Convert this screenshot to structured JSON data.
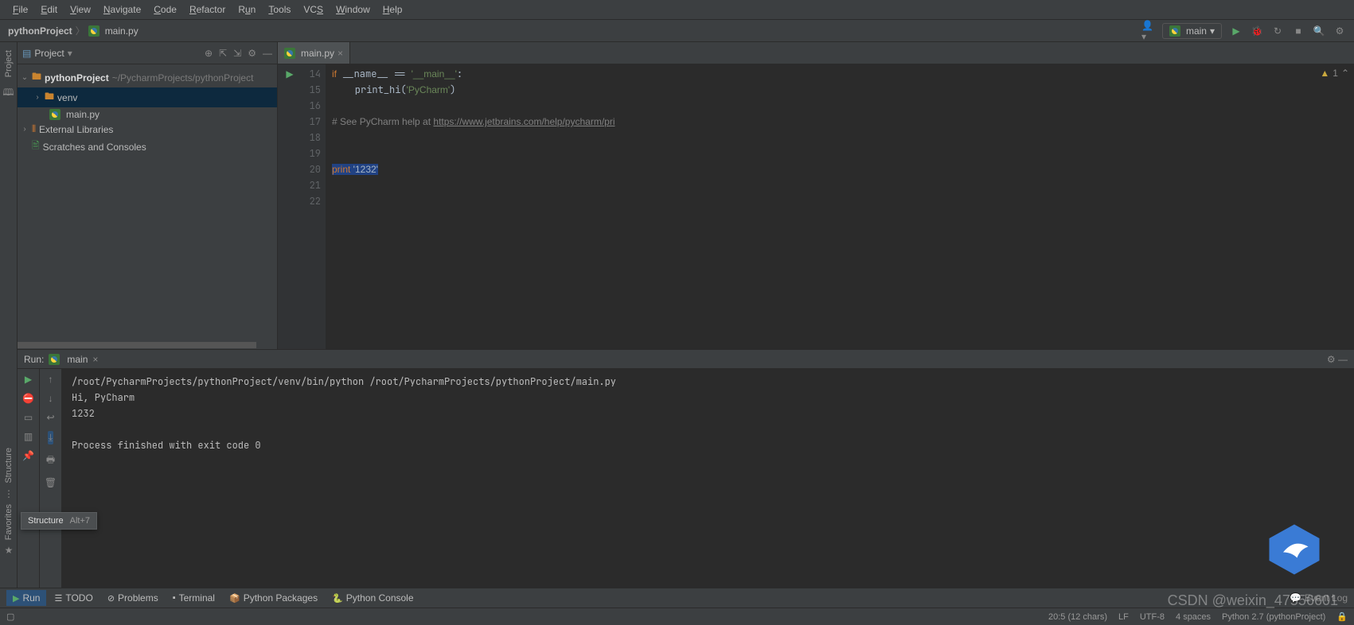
{
  "menu": {
    "items": [
      "File",
      "Edit",
      "View",
      "Navigate",
      "Code",
      "Refactor",
      "Run",
      "Tools",
      "VCS",
      "Window",
      "Help"
    ]
  },
  "breadcrumb": {
    "root": "pythonProject",
    "file": "main.py"
  },
  "runconfig": {
    "name": "main"
  },
  "project_panel": {
    "title": "Project",
    "tree": {
      "root": {
        "name": "pythonProject",
        "path": "~/PycharmProjects/pythonProject"
      },
      "venv": "venv",
      "file": "main.py",
      "ext_lib": "External Libraries",
      "scratches": "Scratches and Consoles"
    }
  },
  "editor": {
    "tab": "main.py",
    "warnings_count": "1",
    "lines": [
      {
        "n": "14",
        "type": "code",
        "content": "if __name__ == '__main__':",
        "run_marker": true
      },
      {
        "n": "15",
        "type": "code",
        "content": "    print_hi('PyCharm')"
      },
      {
        "n": "16",
        "type": "blank",
        "content": ""
      },
      {
        "n": "17",
        "type": "comment",
        "content": "# See PyCharm help at ",
        "url": "https://www.jetbrains.com/help/pycharm/pri"
      },
      {
        "n": "18",
        "type": "blank",
        "content": ""
      },
      {
        "n": "19",
        "type": "blank",
        "content": ""
      },
      {
        "n": "20",
        "type": "selected",
        "kw": "print",
        "rest": " '1232'"
      },
      {
        "n": "21",
        "type": "blank",
        "content": ""
      },
      {
        "n": "22",
        "type": "blank",
        "content": ""
      }
    ]
  },
  "run": {
    "label": "Run:",
    "target": "main",
    "output": "/root/PycharmProjects/pythonProject/venv/bin/python /root/PycharmProjects/pythonProject/main.py\nHi, PyCharm\n1232\n\nProcess finished with exit code 0"
  },
  "tooltip": {
    "label": "Structure",
    "shortcut": "Alt+7"
  },
  "left_stripe": {
    "project": "Project",
    "structure": "Structure",
    "favorites": "Favorites"
  },
  "bottom_tabs": {
    "run": "Run",
    "todo": "TODO",
    "problems": "Problems",
    "terminal": "Terminal",
    "py_packages": "Python Packages",
    "py_console": "Python Console",
    "event_log": "Event Log"
  },
  "status": {
    "pos": "20:5 (12 chars)",
    "eol": "LF",
    "enc": "UTF-8",
    "indent": "4 spaces",
    "interpreter": "Python 2.7 (pythonProject)",
    "watermark": "CSDN @weixin_47556601"
  }
}
